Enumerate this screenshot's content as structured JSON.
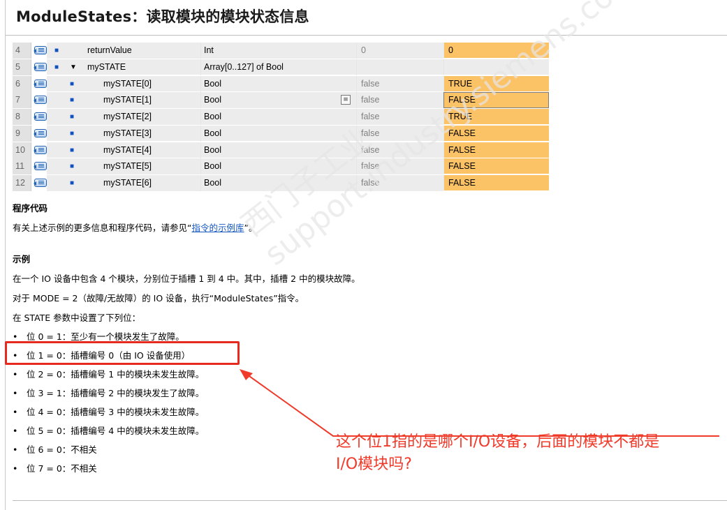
{
  "title": "ModuleStates：读取模块的模块状态信息",
  "table": {
    "rows": [
      {
        "num": "4",
        "name": "returnValue",
        "type": "Int",
        "default": "0",
        "value": "0",
        "child": false,
        "expand": false,
        "value_style": "orange"
      },
      {
        "num": "5",
        "name": "mySTATE",
        "type": "Array[0..127] of Bool",
        "default": "",
        "value": "",
        "child": false,
        "expand": true,
        "value_style": "gray"
      },
      {
        "num": "6",
        "name": "mySTATE[0]",
        "type": "Bool",
        "default": "false",
        "value": "TRUE",
        "child": true,
        "expand": false,
        "value_style": "orange"
      },
      {
        "num": "7",
        "name": "mySTATE[1]",
        "type": "Bool",
        "default": "false",
        "value": "FALSE",
        "child": true,
        "expand": false,
        "value_style": "selected"
      },
      {
        "num": "8",
        "name": "mySTATE[2]",
        "type": "Bool",
        "default": "false",
        "value": "TRUE",
        "child": true,
        "expand": false,
        "value_style": "orange"
      },
      {
        "num": "9",
        "name": "mySTATE[3]",
        "type": "Bool",
        "default": "false",
        "value": "FALSE",
        "child": true,
        "expand": false,
        "value_style": "orange"
      },
      {
        "num": "10",
        "name": "mySTATE[4]",
        "type": "Bool",
        "default": "false",
        "value": "FALSE",
        "child": true,
        "expand": false,
        "value_style": "orange"
      },
      {
        "num": "11",
        "name": "mySTATE[5]",
        "type": "Bool",
        "default": "false",
        "value": "FALSE",
        "child": true,
        "expand": false,
        "value_style": "orange"
      },
      {
        "num": "12",
        "name": "mySTATE[6]",
        "type": "Bool",
        "default": "false",
        "value": "FALSE",
        "child": true,
        "expand": false,
        "value_style": "orange"
      }
    ]
  },
  "program_code": {
    "heading": "程序代码",
    "text_before": "有关上述示例的更多信息和程序代码，请参见“",
    "link": "指令的示例库",
    "text_after": "”。"
  },
  "example": {
    "heading": "示例",
    "lines": [
      "在一个 IO 设备中包含 4 个模块，分别位于插槽 1 到 4 中。其中，插槽 2 中的模块故障。",
      "对于 MODE = 2（故障/无故障）的 IO 设备，执行“ModuleStates”指令。",
      "在 STATE 参数中设置了下列位："
    ],
    "bullets": [
      "位 0 = 1：至少有一个模块发生了故障。",
      "位 1 = 0：插槽编号 0（由 IO 设备使用）",
      "位 2 = 0：插槽编号 1 中的模块未发生故障。",
      "位 3 = 1：插槽编号 2 中的模块发生了故障。",
      "位 4 = 0：插槽编号 3 中的模块未发生故障。",
      "位 5 = 0：插槽编号 4 中的模块未发生故障。",
      "位 6 = 0：不相关",
      "位 7 = 0：不相关"
    ]
  },
  "annotation": {
    "line1": "这个位1指的是哪个I/O设备，后面的模块不都是",
    "line2": "I/O模块吗?",
    "color": "#f03a2a"
  },
  "watermark": "西门子工业 support.industry.siemens.com/cs"
}
